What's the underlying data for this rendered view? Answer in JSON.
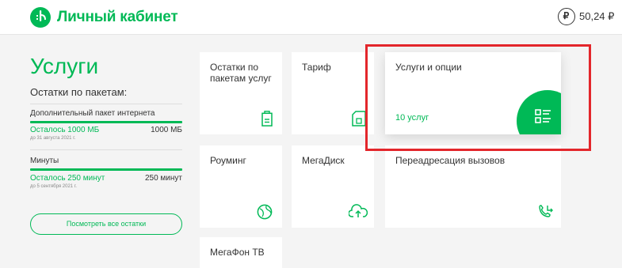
{
  "header": {
    "title": "Личный кабинет",
    "balance": "50,24 ₽",
    "currency_symbol": "₽",
    "icons": [
      "megafon-logo-icon",
      "ruble-icon"
    ]
  },
  "sidebar": {
    "page_title": "Услуги",
    "remaining_heading": "Остатки по пакетам:",
    "packages": [
      {
        "name": "Дополнительный пакет интернета",
        "remaining": "Осталось 1000 МБ",
        "total": "1000 МБ",
        "valid_until": "до 31 августа 2021 г.",
        "fill": 1.0
      },
      {
        "name": "Минуты",
        "remaining": "Осталось 250 минут",
        "total": "250 минут",
        "valid_until": "до 5 сентября 2021 г.",
        "fill": 1.0
      }
    ],
    "all_button": "Посмотреть все остатки"
  },
  "tiles": {
    "package_remains": {
      "label": "Остатки по пакетам услуг",
      "icon": "battery-icon"
    },
    "tariff": {
      "label": "Тариф",
      "icon": "sim-card-icon"
    },
    "services": {
      "label": "Услуги и опции",
      "count": "10 услуг",
      "icon": "list-icon"
    },
    "roaming": {
      "label": "Роуминг",
      "icon": "globe-icon"
    },
    "megadisk": {
      "label": "МегаДиск",
      "icon": "cloud-upload-icon"
    },
    "forwarding": {
      "label": "Переадресация вызовов",
      "icon": "call-forward-icon"
    },
    "megafon_tv": {
      "label": "МегаФон ТВ"
    }
  },
  "colors": {
    "brand_green": "#00b956",
    "highlight_red": "#e3262b",
    "background": "#f4f4f4"
  }
}
